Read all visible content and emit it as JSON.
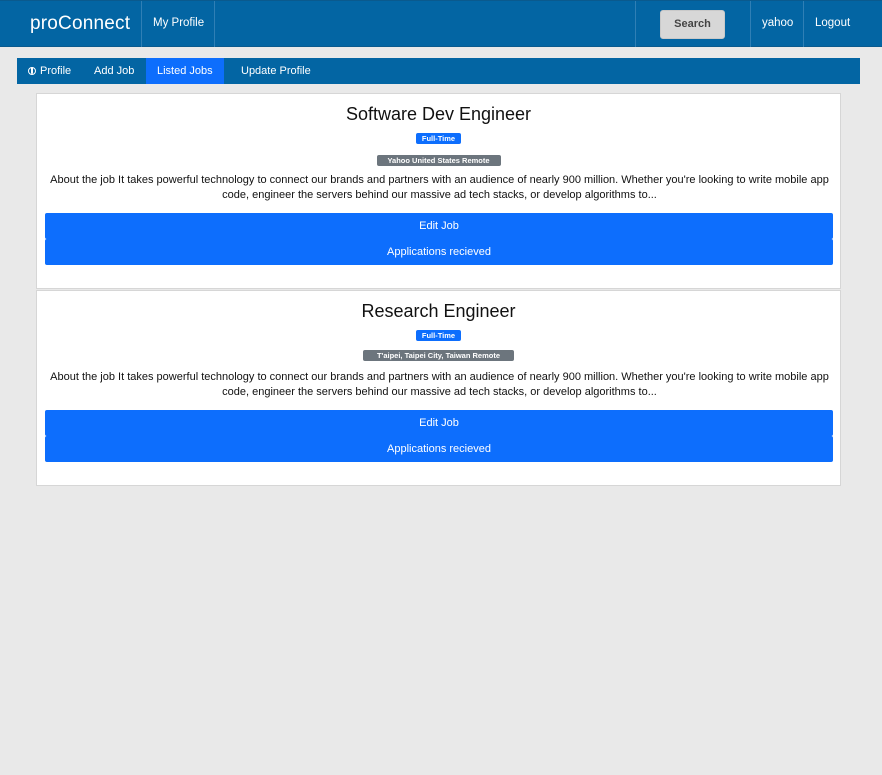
{
  "navbar": {
    "brand": "proConnect",
    "my_profile": "My Profile",
    "search": "Search",
    "username": "yahoo",
    "logout": "Logout"
  },
  "tabs": [
    {
      "label": "Profile",
      "icon": "globe-icon",
      "active": false
    },
    {
      "label": "Add Job",
      "active": false
    },
    {
      "label": "Listed Jobs",
      "active": true
    },
    {
      "label": "Update Profile",
      "active": false
    }
  ],
  "jobs": [
    {
      "title": "Software Dev Engineer",
      "type": "Full-Time",
      "location": "Yahoo United States Remote",
      "description": "About the job It takes powerful technology to connect our brands and partners with an audience of nearly 900 million. Whether you're looking to write mobile app code, engineer the servers behind our massive ad tech stacks, or develop algorithms to...",
      "edit_label": "Edit Job",
      "applications_label": "Applications recieved"
    },
    {
      "title": "Research Engineer",
      "type": "Full-Time",
      "location": "T'aipei, Taipei City, Taiwan Remote",
      "description": "About the job It takes powerful technology to connect our brands and partners with an audience of nearly 900 million. Whether you're looking to write mobile app code, engineer the servers behind our massive ad tech stacks, or develop algorithms to...",
      "edit_label": "Edit Job",
      "applications_label": "Applications recieved"
    }
  ],
  "colors": {
    "navbar": "#0365a3",
    "primary": "#0d6efd",
    "secondary": "#6c757d",
    "background": "#e9e9e9"
  }
}
